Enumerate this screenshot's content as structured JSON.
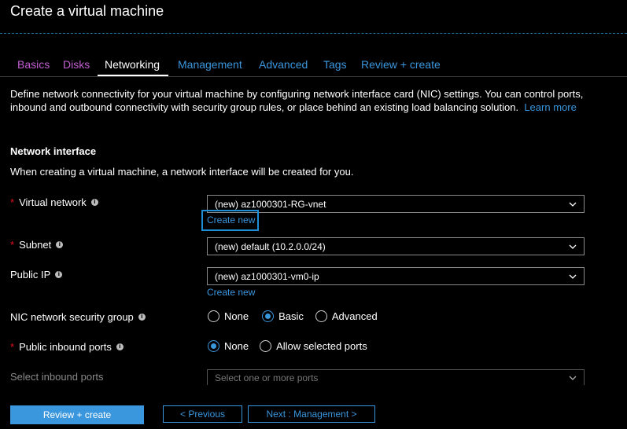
{
  "header": {
    "title": "Create a virtual machine"
  },
  "tabs": [
    {
      "label": "Basics"
    },
    {
      "label": "Disks"
    },
    {
      "label": "Networking"
    },
    {
      "label": "Management"
    },
    {
      "label": "Advanced"
    },
    {
      "label": "Tags"
    },
    {
      "label": "Review + create"
    }
  ],
  "description": {
    "text": "Define network connectivity for your virtual machine by configuring network interface card (NIC) settings. You can control ports, inbound and outbound connectivity with security group rules, or place behind an existing load balancing solution.",
    "learn_more": "Learn more"
  },
  "network_interface": {
    "heading": "Network interface",
    "subtext": "When creating a virtual machine, a network interface will be created for you."
  },
  "fields": {
    "virtual_network": {
      "label": "Virtual network",
      "value": "(new) az1000301-RG-vnet",
      "create_new": "Create new"
    },
    "subnet": {
      "label": "Subnet",
      "value": "(new) default (10.2.0.0/24)"
    },
    "public_ip": {
      "label": "Public IP",
      "value": "(new) az1000301-vm0-ip",
      "create_new": "Create new"
    },
    "nic_nsg": {
      "label": "NIC network security group",
      "options": [
        "None",
        "Basic",
        "Advanced"
      ],
      "selected": "Basic"
    },
    "public_inbound_ports": {
      "label": "Public inbound ports",
      "options": [
        "None",
        "Allow selected ports"
      ],
      "selected": "None"
    },
    "select_inbound_ports": {
      "label": "Select inbound ports",
      "placeholder": "Select one or more ports"
    }
  },
  "footer": {
    "review_create": "Review + create",
    "previous": "< Previous",
    "next": "Next : Management >"
  },
  "colors": {
    "accent": "#3a96dd",
    "visited": "#c15dd0",
    "required": "#e81123"
  }
}
